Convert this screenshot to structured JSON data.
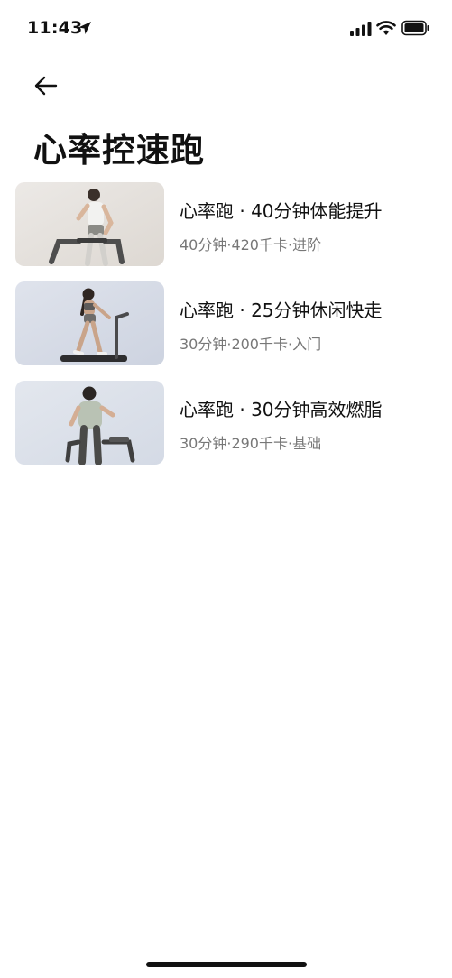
{
  "status_bar": {
    "time": "11:43"
  },
  "header": {
    "title": "心率控速跑"
  },
  "workouts": [
    {
      "title": "心率跑 · 40分钟体能提升",
      "meta": "40分钟·420千卡·进阶"
    },
    {
      "title": "心率跑 · 25分钟休闲快走",
      "meta": "30分钟·200千卡·入门"
    },
    {
      "title": "心率跑 · 30分钟高效燃脂",
      "meta": "30分钟·290千卡·基础"
    }
  ]
}
